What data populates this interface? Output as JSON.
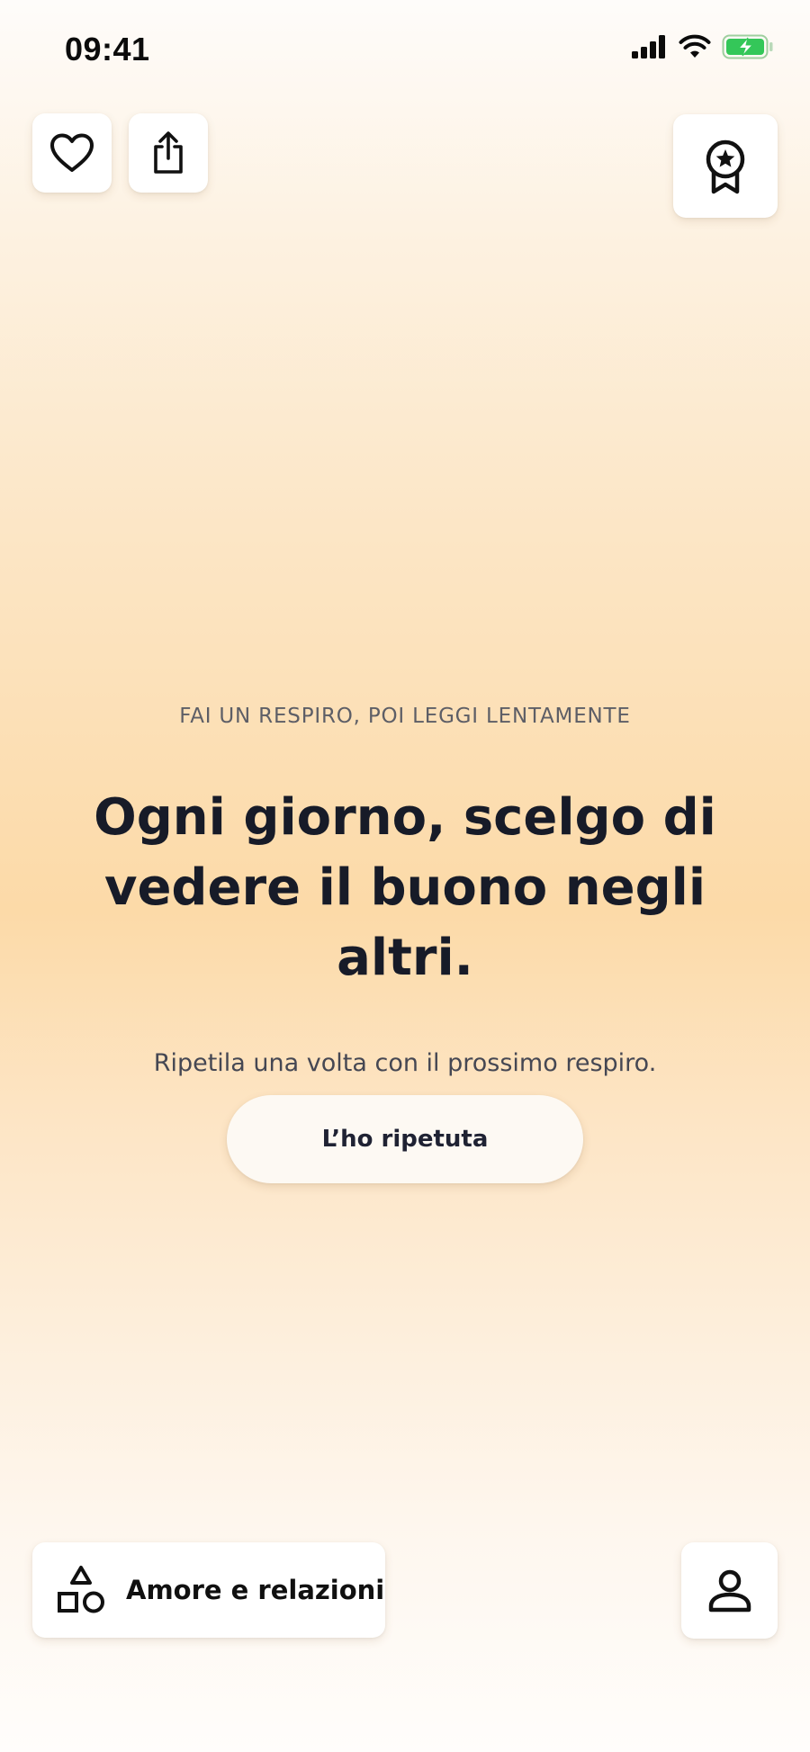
{
  "status_bar": {
    "time": "09:41",
    "icons": [
      "cellular-signal-icon",
      "wifi-icon",
      "battery-charging-icon"
    ],
    "battery_color": "#34c759"
  },
  "top_actions": {
    "favorite_icon": "heart-icon",
    "share_icon": "share-icon",
    "achievements_icon": "award-badge-icon"
  },
  "content": {
    "kicker": "FAI UN RESPIRO, POI LEGGI LENTAMENTE",
    "affirmation": "Ogni giorno, scelgo di vedere il buono negli altri.",
    "hint": "Ripetila una volta con il prossimo respiro.",
    "repeat_button_label": "L’ho ripetuta"
  },
  "bottom_bar": {
    "category_icon": "shapes-icon",
    "category_label": "Amore e relazioni",
    "profile_icon": "user-icon"
  },
  "colors": {
    "background_top": "#fefcfa",
    "background_mid": "#fcdaa8",
    "text_primary": "#171b28",
    "text_secondary": "#5d5e66",
    "card_background": "#ffffff"
  }
}
